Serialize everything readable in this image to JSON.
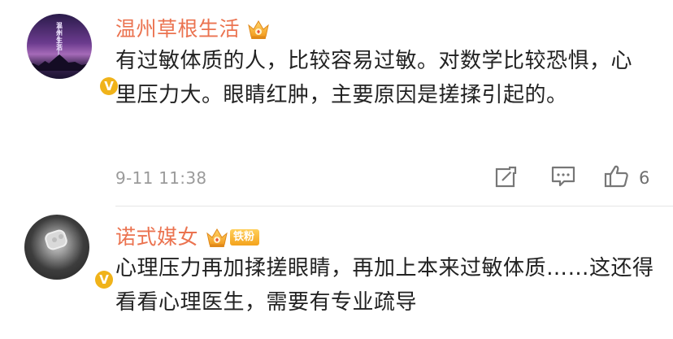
{
  "comments": [
    {
      "username": "温州草根生活",
      "text": "有过敏体质的人，比较容易过敏。对数学比较恐惧，心里压力大。眼睛红肿，主要原因是搓揉引起的。",
      "timestamp": "9-11 11:38",
      "like_count": "6",
      "avatar_tag": "温州生活",
      "badges": [
        "crown-icon"
      ]
    },
    {
      "username": "诺式媒女",
      "text": "心理压力再加揉搓眼睛，再加上本来过敏体质……这还得看看心理医生，需要有专业疏导",
      "fan_badge": "铁粉",
      "badges": [
        "crown-icon",
        "fan-badge"
      ]
    }
  ],
  "verified_badge": "V",
  "colors": {
    "username": "#eb7350",
    "text": "#222222",
    "timestamp": "#9b9b9b",
    "badge_gold": "#f0b31a"
  }
}
